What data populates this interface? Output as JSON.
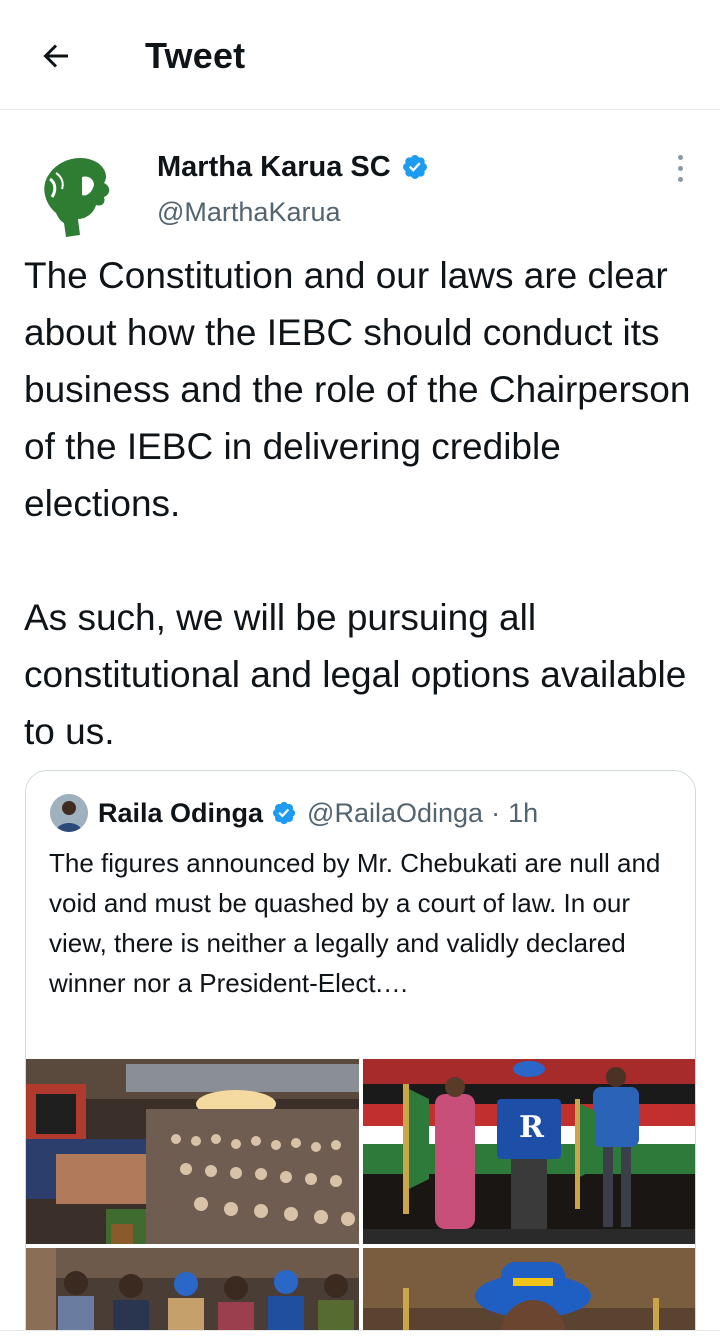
{
  "header": {
    "title": "Tweet",
    "back_icon": "arrow-left-icon"
  },
  "tweet": {
    "author_name": "Martha Karua SC",
    "author_handle": "@MarthaKarua",
    "text": "The Constitution and our laws are clear about how the IEBC should conduct its business and the role of the Chairperson of the IEBC in delivering credible elections.\n\nAs such, we will be pursuing all constitutional and legal options available to us."
  },
  "quoted_tweet": {
    "author_name": "Raila Odinga",
    "author_handle": "@RailaOdinga",
    "separator": "·",
    "time": "1h",
    "text": "The figures announced by Mr. Chebukati are null and void and must be quashed by a court of law.  In our view, there is neither a legally and validly declared winner nor a President-Elect.…",
    "media": [
      "conference-hall-audience-photo",
      "podium-speakers-photo",
      "group-standing-photo",
      "speaker-blue-hat-photo"
    ]
  },
  "colors": {
    "text": "#0f1419",
    "secondary_text": "#536471",
    "verified_blue": "#1d9bf0",
    "border": "#cfd9de",
    "avatar_green": "#2e7d32"
  }
}
